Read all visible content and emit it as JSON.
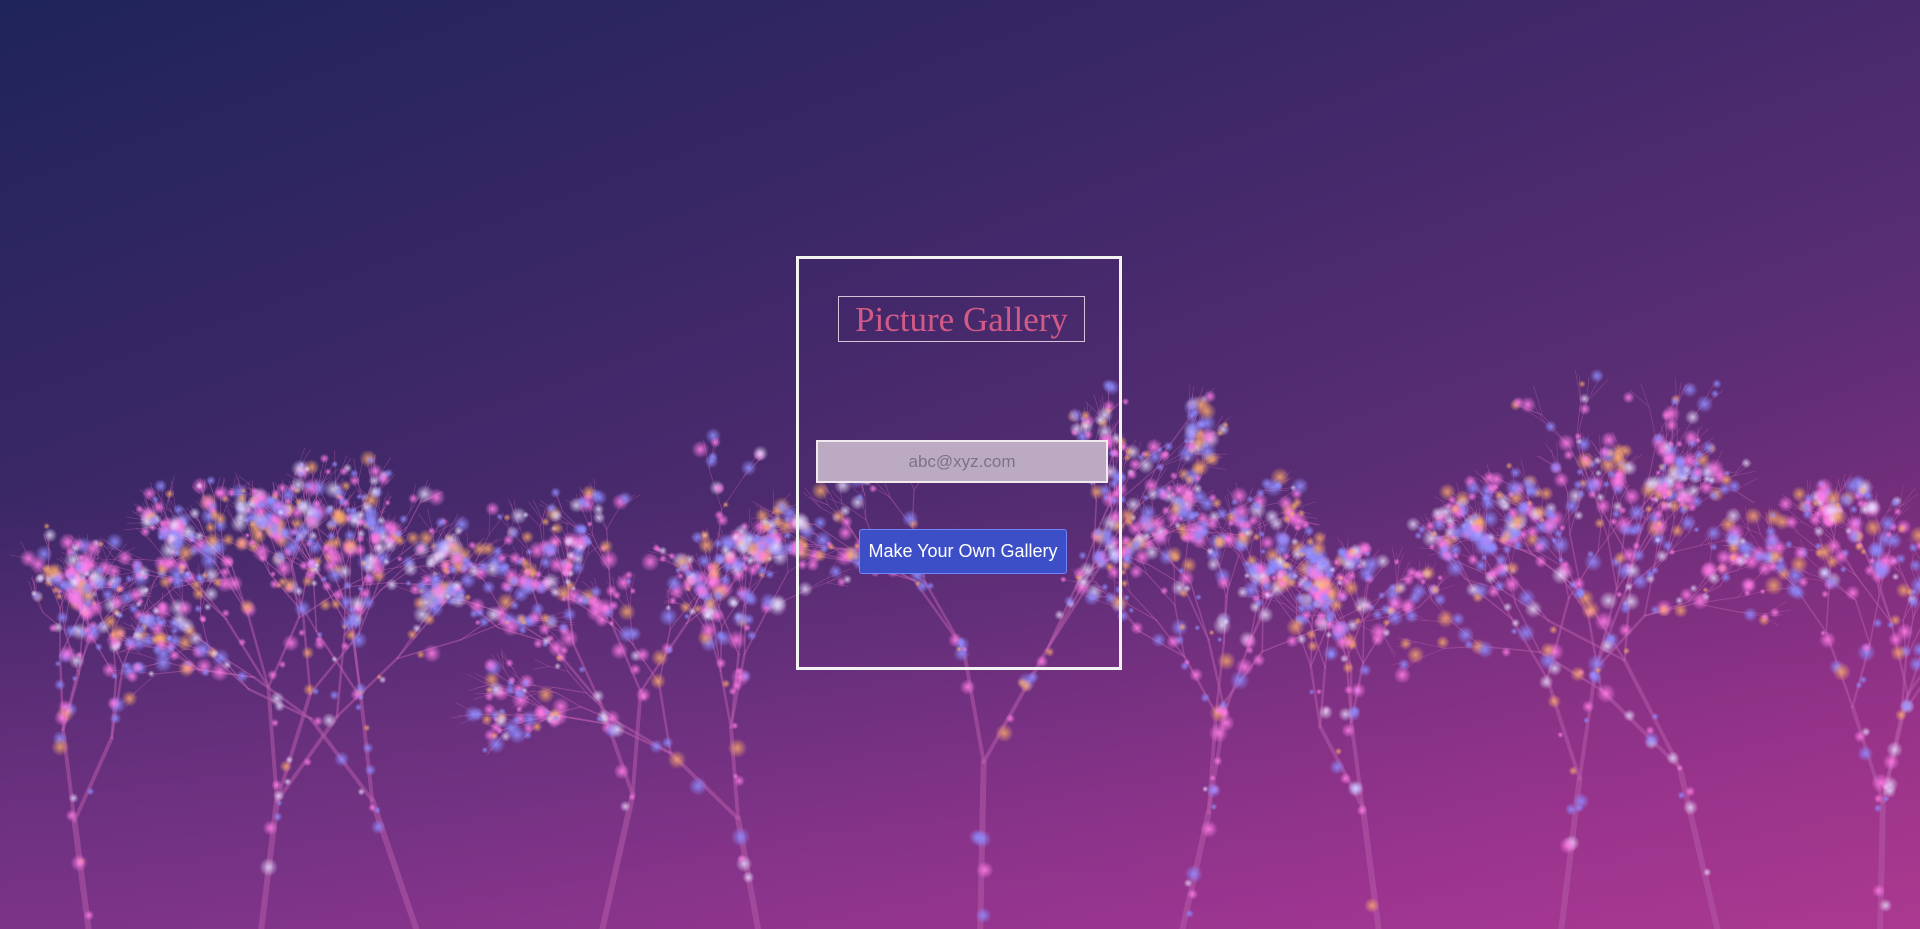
{
  "gallery": {
    "title": "Picture Gallery",
    "email_placeholder": "abc@xyz.com",
    "email_value": "",
    "button_label": "Make Your Own Gallery"
  },
  "background": {
    "description_icon": "tree-lights-background",
    "gradient_start": "#1e2458",
    "gradient_end": "#a0357f"
  }
}
